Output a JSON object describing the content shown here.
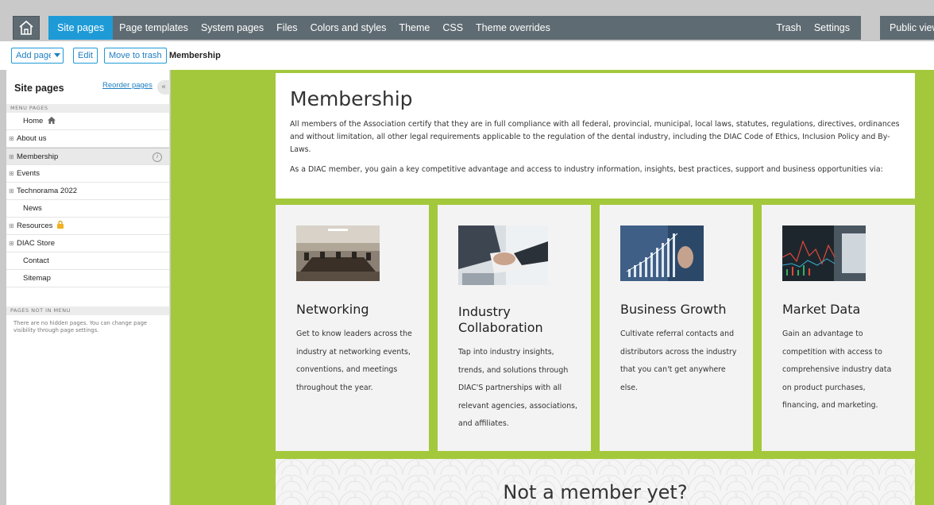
{
  "topbar": {
    "nav": [
      "Site pages",
      "Page templates",
      "System pages",
      "Files",
      "Colors and styles",
      "Theme",
      "CSS",
      "Theme overrides"
    ],
    "right": [
      "Trash",
      "Settings"
    ],
    "public_view": "Public view",
    "active_index": 0
  },
  "toolbar": {
    "add_page": "Add page",
    "edit": "Edit",
    "move_to_trash": "Move to trash",
    "current_page": "Membership"
  },
  "sidebar": {
    "title": "Site pages",
    "reorder": "Reorder pages",
    "section_menu": "MENU PAGES",
    "items": [
      {
        "label": "Home",
        "expandable": false,
        "icon": "house-icon"
      },
      {
        "label": "About us",
        "expandable": true
      },
      {
        "label": "Membership",
        "expandable": true,
        "selected": true
      },
      {
        "label": "Events",
        "expandable": true
      },
      {
        "label": "Technorama 2022",
        "expandable": true
      },
      {
        "label": "News",
        "expandable": false
      },
      {
        "label": "Resources",
        "expandable": true,
        "icon": "lock-icon"
      },
      {
        "label": "DIAC Store",
        "expandable": true
      },
      {
        "label": "Contact",
        "expandable": false
      },
      {
        "label": "Sitemap",
        "expandable": false
      }
    ],
    "section_hidden": "PAGES NOT IN MENU",
    "hidden_note": "There are no hidden pages. You can change page visibility through page settings."
  },
  "content": {
    "title": "Membership",
    "para1": "All members of the Association certify that they are in full compliance with all federal, provincial, municipal, local laws, statutes, regulations, directives, ordinances and without limitation, all other legal requirements applicable to the regulation of the dental industry, including the DIAC Code of Ethics, Inclusion Policy and By-Laws.",
    "para2": "As a DIAC member, you gain a key competitive advantage and access to industry information, insights, best practices, support and business opportunities via:",
    "cards": [
      {
        "title": "Networking",
        "text": "Get to know leaders across the industry at networking events, conventions, and meetings throughout the year.",
        "image": "conference-room-photo"
      },
      {
        "title": "Industry Collaboration",
        "text": "Tap into industry insights, trends, and solutions through DIAC'S partnerships with all relevant agencies, associations, and affiliates.",
        "image": "handshake-photo"
      },
      {
        "title": "Business Growth",
        "text": "Cultivate referral contacts and distributors across the industry that you can't get anywhere else.",
        "image": "growth-chart-photo"
      },
      {
        "title": "Market Data",
        "text": "Gain an advantage to competition with access to comprehensive industry data on product purchases, financing, and marketing.",
        "image": "stock-chart-photo"
      }
    ],
    "banner_title": "Not a member yet?"
  },
  "colors": {
    "nav_bg": "#5f6b72",
    "nav_active": "#1e9bd7",
    "canvas_green": "#a4c83b"
  }
}
